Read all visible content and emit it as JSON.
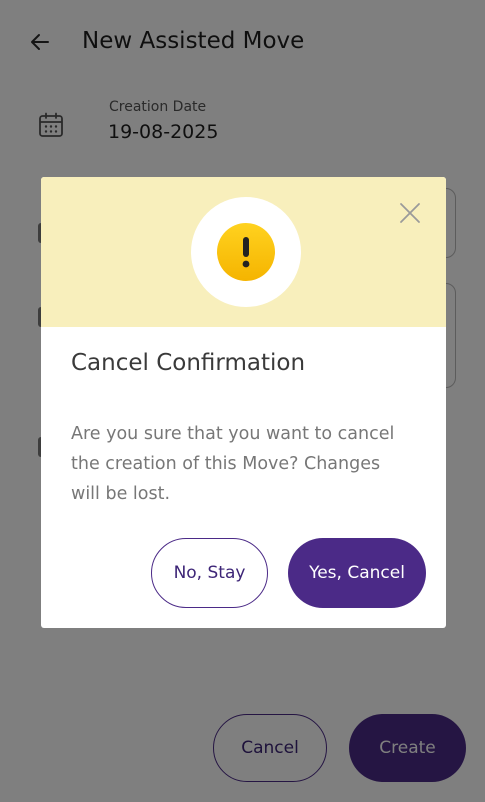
{
  "header": {
    "title": "New Assisted Move",
    "back_icon": "arrow-left-icon"
  },
  "form": {
    "creation_date_label": "Creation Date",
    "creation_date_value": "19-08-2025",
    "date_icon": "calendar-icon"
  },
  "footer": {
    "cancel_label": "Cancel",
    "create_label": "Create"
  },
  "dialog": {
    "icon": "warning-icon",
    "title": "Cancel Confirmation",
    "message": "Are you sure that you want to cancel the creation of this Move? Changes will be lost.",
    "stay_label": "No, Stay",
    "confirm_label": "Yes, Cancel",
    "close_icon": "close-icon"
  },
  "colors": {
    "primary": "#4b2a87",
    "warning_banner": "#f8efbc",
    "warning_icon": "#f5b400"
  }
}
